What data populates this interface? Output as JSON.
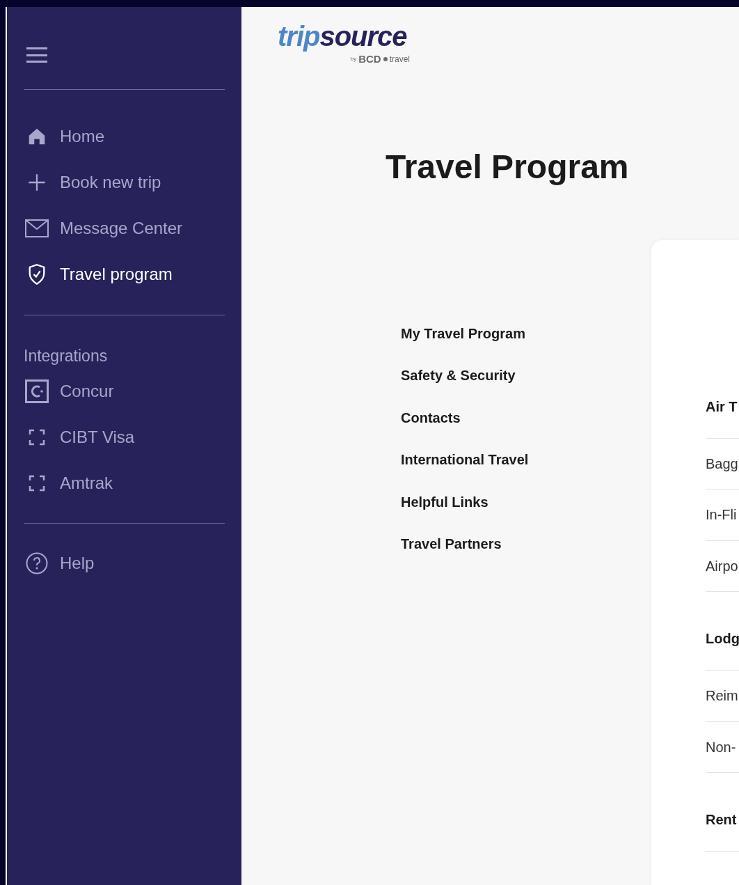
{
  "logo": {
    "word_1": "trip",
    "word_2": "source",
    "byline_prefix": "by",
    "byline_brand": "BCD",
    "byline_suffix": "travel"
  },
  "sidebar": {
    "items": [
      {
        "label": "Home",
        "kind": "home",
        "selected": false
      },
      {
        "label": "Book new trip",
        "kind": "plus",
        "selected": false
      },
      {
        "label": "Message Center",
        "kind": "mail",
        "selected": false
      },
      {
        "label": "Travel program",
        "kind": "shield",
        "selected": true
      }
    ],
    "integrations_heading": "Integrations",
    "integrations": [
      {
        "label": "Concur",
        "kind": "concur"
      },
      {
        "label": "CIBT Visa",
        "kind": "frame"
      },
      {
        "label": "Amtrak",
        "kind": "frame"
      }
    ],
    "help": {
      "label": "Help"
    }
  },
  "page_title": "Travel Program",
  "section_nav": [
    "My Travel Program",
    "Safety & Security",
    "Contacts",
    "International Travel",
    "Helpful Links",
    "Travel Partners"
  ],
  "card": {
    "sections": [
      {
        "heading": "Air T",
        "items": [
          "Bagg",
          "In-Fli",
          "Airpo"
        ]
      },
      {
        "heading": "Lodg",
        "items": [
          "Reim",
          "Non-"
        ]
      },
      {
        "heading": "Rent"
      }
    ]
  }
}
